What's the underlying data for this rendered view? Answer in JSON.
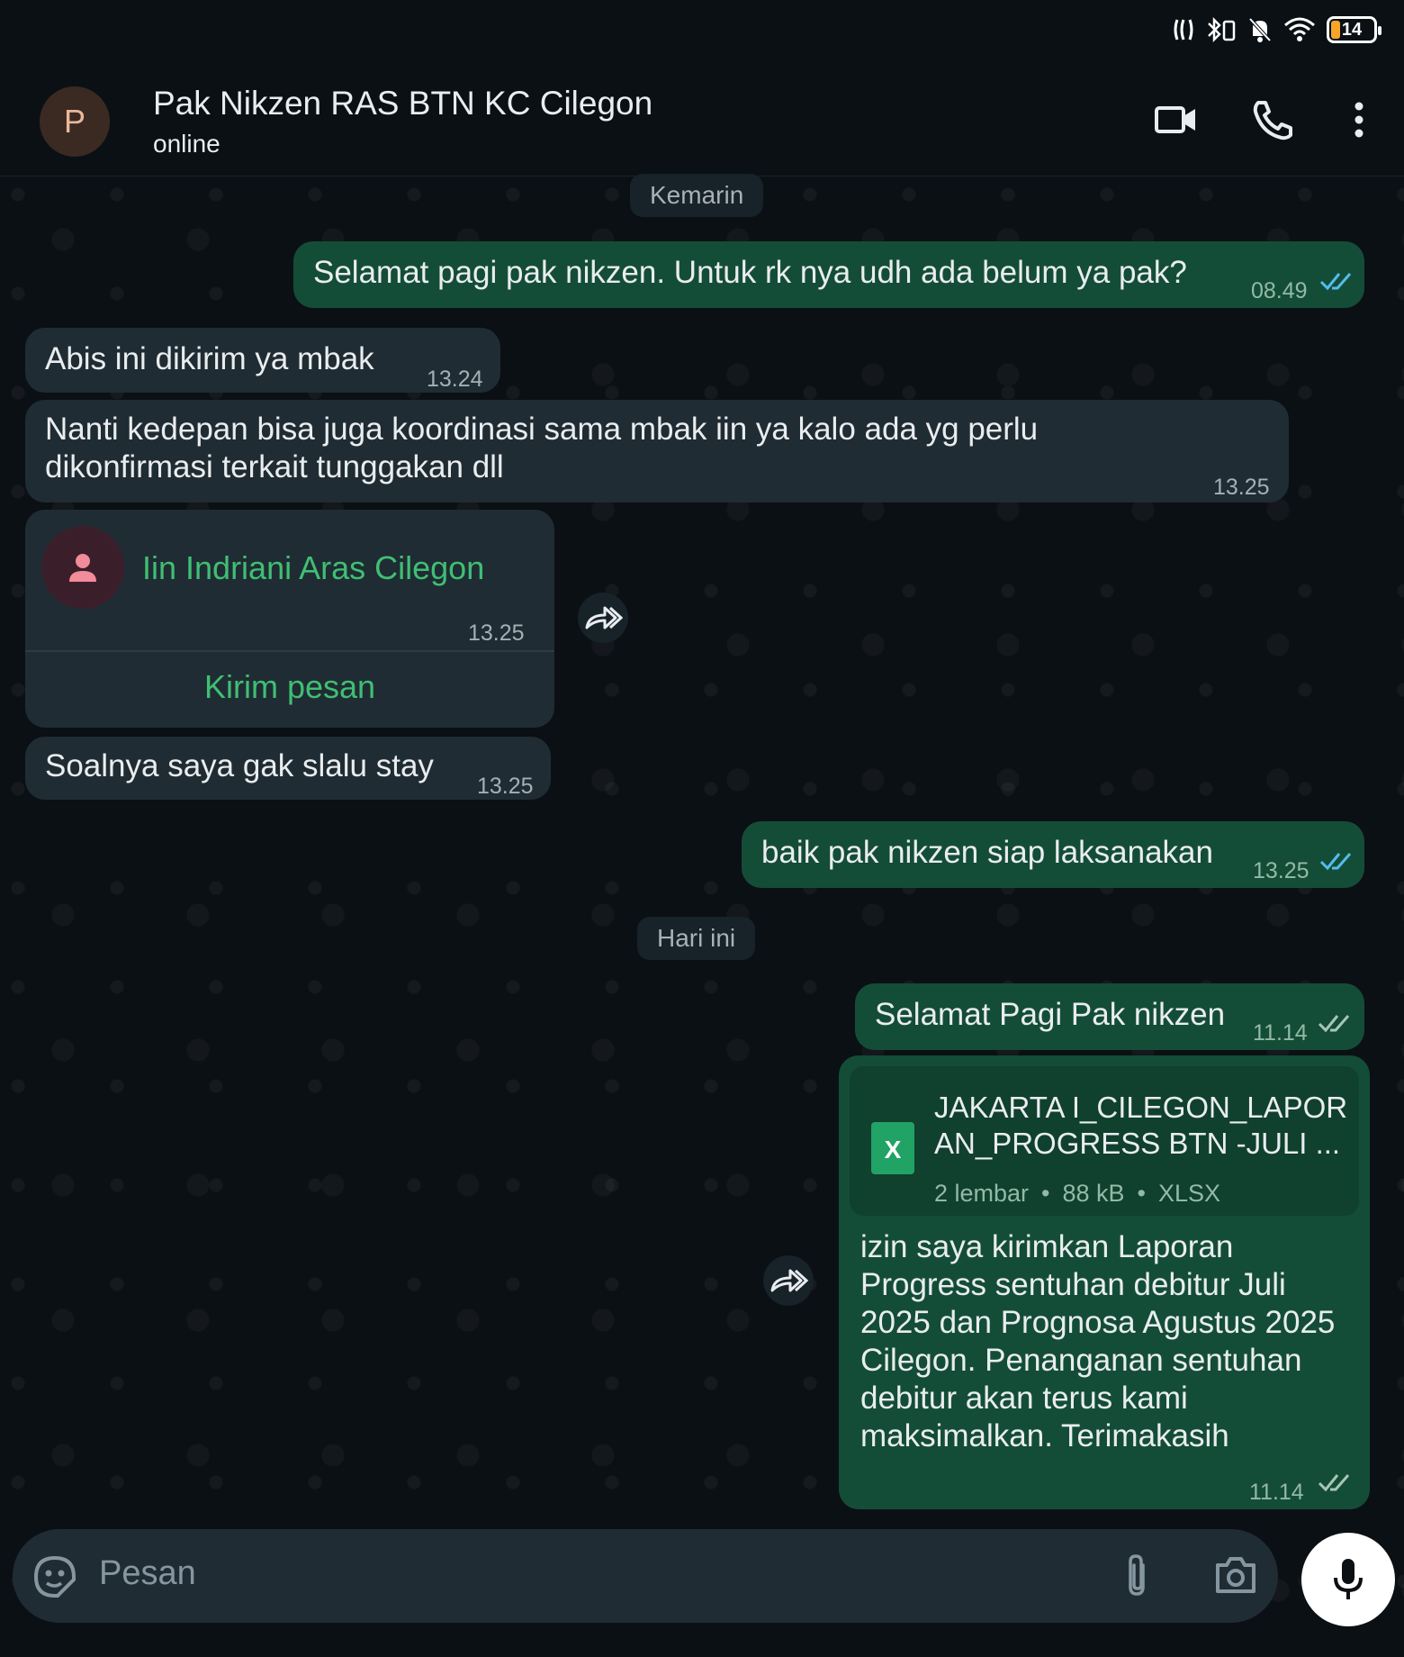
{
  "status_bar": {
    "battery": "14"
  },
  "header": {
    "avatar_letter": "P",
    "name": "Pak Nikzen RAS BTN KC Cilegon",
    "status": "online"
  },
  "chips": {
    "yesterday": "Kemarin",
    "today": "Hari ini"
  },
  "messages": {
    "m1": {
      "text": "Selamat pagi pak nikzen. Untuk rk nya udh ada belum ya pak?",
      "time": "08.49"
    },
    "m2": {
      "text": "Abis ini dikirim ya mbak",
      "time": "13.24"
    },
    "m3": {
      "text": "Nanti kedepan bisa juga koordinasi sama mbak iin ya kalo ada yg perlu dikonfirmasi terkait tunggakan dll",
      "time": "13.25"
    },
    "contact": {
      "name": "Iin Indriani Aras Cilegon",
      "time": "13.25",
      "action": "Kirim pesan"
    },
    "m4": {
      "text": "Soalnya saya gak slalu stay",
      "time": "13.25"
    },
    "m5": {
      "text": "baik pak nikzen siap laksanakan",
      "time": "13.25"
    },
    "m6": {
      "text": "Selamat Pagi Pak nikzen",
      "time": "11.14"
    },
    "file": {
      "name_line1": "JAKARTA I_CILEGON_LAPOR",
      "name_line2": "AN_PROGRESS BTN -JULI ...",
      "pages": "2 lembar",
      "size": "88 kB",
      "type": "XLSX",
      "icon_letter": "X",
      "caption": "izin saya kirimkan Laporan Progress sentuhan debitur Juli 2025 dan Prognosa Agustus 2025 Cilegon. Penanganan sentuhan debitur akan terus kami maksimalkan. Terimakasih",
      "time": "11.14"
    }
  },
  "composer": {
    "placeholder": "Pesan"
  },
  "colors": {
    "incoming": "#202c33",
    "outgoing": "#144d37",
    "accent_green": "#21c063",
    "read_ticks": "#53bdeb"
  }
}
